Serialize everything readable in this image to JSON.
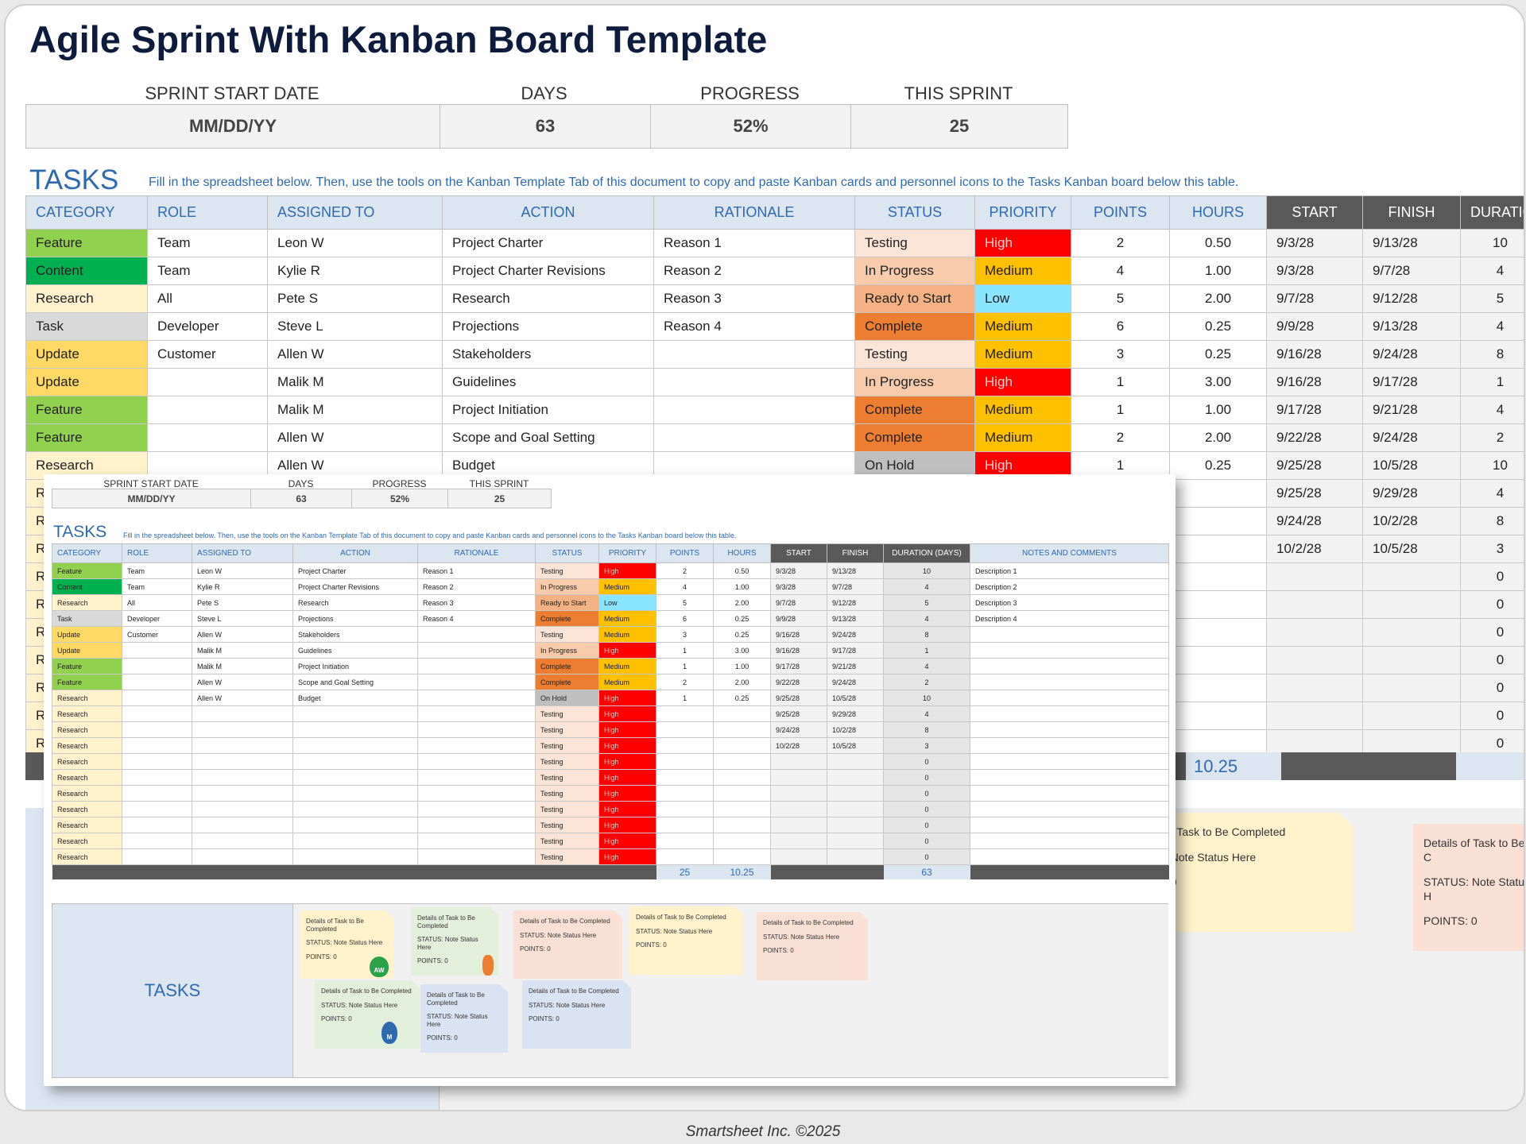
{
  "title": "Agile Sprint With Kanban Board Template",
  "summary": {
    "labels": [
      "SPRINT START DATE",
      "DAYS",
      "PROGRESS",
      "THIS SPRINT"
    ],
    "values": [
      "MM/DD/YY",
      "63",
      "52%",
      "25"
    ]
  },
  "tasks_heading": "TASKS",
  "instructions": "Fill in the spreadsheet below. Then, use the tools on the Kanban Template Tab of this document to copy and paste Kanban cards and personnel icons to the Tasks Kanban board below this table.",
  "columns": [
    "CATEGORY",
    "ROLE",
    "ASSIGNED TO",
    "ACTION",
    "RATIONALE",
    "STATUS",
    "PRIORITY",
    "POINTS",
    "HOURS",
    "START",
    "FINISH",
    "DURATION (DAYS)",
    "NOTES AND COMMENTS"
  ],
  "big_columns": [
    "CATEGORY",
    "ROLE",
    "ASSIGNED TO",
    "ACTION",
    "RATIONALE",
    "STATUS",
    "PRIORITY",
    "POINTS",
    "HOURS",
    "START",
    "FINISH",
    "DURATIC"
  ],
  "rows": [
    {
      "category": "Feature",
      "role": "Team",
      "assigned": "Leon W",
      "action": "Project Charter",
      "rationale": "Reason 1",
      "status": "Testing",
      "priority": "High",
      "points": "2",
      "hours": "0.50",
      "start": "9/3/28",
      "finish": "9/13/28",
      "duration": "10",
      "notes": "Description 1"
    },
    {
      "category": "Content",
      "role": "Team",
      "assigned": "Kylie R",
      "action": "Project Charter Revisions",
      "rationale": "Reason 2",
      "status": "In Progress",
      "priority": "Medium",
      "points": "4",
      "hours": "1.00",
      "start": "9/3/28",
      "finish": "9/7/28",
      "duration": "4",
      "notes": "Description 2"
    },
    {
      "category": "Research",
      "role": "All",
      "assigned": "Pete S",
      "action": "Research",
      "rationale": "Reason 3",
      "status": "Ready to Start",
      "priority": "Low",
      "points": "5",
      "hours": "2.00",
      "start": "9/7/28",
      "finish": "9/12/28",
      "duration": "5",
      "notes": "Description 3"
    },
    {
      "category": "Task",
      "role": "Developer",
      "assigned": "Steve L",
      "action": "Projections",
      "rationale": "Reason 4",
      "status": "Complete",
      "priority": "Medium",
      "points": "6",
      "hours": "0.25",
      "start": "9/9/28",
      "finish": "9/13/28",
      "duration": "4",
      "notes": "Description 4"
    },
    {
      "category": "Update",
      "role": "Customer",
      "assigned": "Allen W",
      "action": "Stakeholders",
      "rationale": "",
      "status": "Testing",
      "priority": "Medium",
      "points": "3",
      "hours": "0.25",
      "start": "9/16/28",
      "finish": "9/24/28",
      "duration": "8",
      "notes": ""
    },
    {
      "category": "Update",
      "role": "",
      "assigned": "Malik M",
      "action": "Guidelines",
      "rationale": "",
      "status": "In Progress",
      "priority": "High",
      "points": "1",
      "hours": "3.00",
      "start": "9/16/28",
      "finish": "9/17/28",
      "duration": "1",
      "notes": ""
    },
    {
      "category": "Feature",
      "role": "",
      "assigned": "Malik M",
      "action": "Project Initiation",
      "rationale": "",
      "status": "Complete",
      "priority": "Medium",
      "points": "1",
      "hours": "1.00",
      "start": "9/17/28",
      "finish": "9/21/28",
      "duration": "4",
      "notes": ""
    },
    {
      "category": "Feature",
      "role": "",
      "assigned": "Allen W",
      "action": "Scope and Goal Setting",
      "rationale": "",
      "status": "Complete",
      "priority": "Medium",
      "points": "2",
      "hours": "2.00",
      "start": "9/22/28",
      "finish": "9/24/28",
      "duration": "2",
      "notes": ""
    },
    {
      "category": "Research",
      "role": "",
      "assigned": "Allen W",
      "action": "Budget",
      "rationale": "",
      "status": "On Hold",
      "priority": "High",
      "points": "1",
      "hours": "0.25",
      "start": "9/25/28",
      "finish": "10/5/28",
      "duration": "10",
      "notes": ""
    },
    {
      "category": "Research",
      "role": "",
      "assigned": "",
      "action": "",
      "rationale": "",
      "status": "Testing",
      "priority": "High",
      "points": "",
      "hours": "",
      "start": "9/25/28",
      "finish": "9/29/28",
      "duration": "4",
      "notes": ""
    },
    {
      "category": "Research",
      "role": "",
      "assigned": "",
      "action": "",
      "rationale": "",
      "status": "Testing",
      "priority": "High",
      "points": "",
      "hours": "",
      "start": "9/24/28",
      "finish": "10/2/28",
      "duration": "8",
      "notes": ""
    },
    {
      "category": "Research",
      "role": "",
      "assigned": "",
      "action": "",
      "rationale": "",
      "status": "Testing",
      "priority": "High",
      "points": "",
      "hours": "",
      "start": "10/2/28",
      "finish": "10/5/28",
      "duration": "3",
      "notes": ""
    },
    {
      "category": "Research",
      "role": "",
      "assigned": "",
      "action": "",
      "rationale": "",
      "status": "Testing",
      "priority": "High",
      "points": "",
      "hours": "",
      "start": "",
      "finish": "",
      "duration": "0",
      "notes": ""
    },
    {
      "category": "Research",
      "role": "",
      "assigned": "",
      "action": "",
      "rationale": "",
      "status": "Testing",
      "priority": "High",
      "points": "",
      "hours": "",
      "start": "",
      "finish": "",
      "duration": "0",
      "notes": ""
    },
    {
      "category": "Research",
      "role": "",
      "assigned": "",
      "action": "",
      "rationale": "",
      "status": "Testing",
      "priority": "High",
      "points": "",
      "hours": "",
      "start": "",
      "finish": "",
      "duration": "0",
      "notes": ""
    },
    {
      "category": "Research",
      "role": "",
      "assigned": "",
      "action": "",
      "rationale": "",
      "status": "Testing",
      "priority": "High",
      "points": "",
      "hours": "",
      "start": "",
      "finish": "",
      "duration": "0",
      "notes": ""
    },
    {
      "category": "Research",
      "role": "",
      "assigned": "",
      "action": "",
      "rationale": "",
      "status": "Testing",
      "priority": "High",
      "points": "",
      "hours": "",
      "start": "",
      "finish": "",
      "duration": "0",
      "notes": ""
    },
    {
      "category": "Research",
      "role": "",
      "assigned": "",
      "action": "",
      "rationale": "",
      "status": "Testing",
      "priority": "High",
      "points": "",
      "hours": "",
      "start": "",
      "finish": "",
      "duration": "0",
      "notes": ""
    },
    {
      "category": "Research",
      "role": "",
      "assigned": "",
      "action": "",
      "rationale": "",
      "status": "Testing",
      "priority": "High",
      "points": "",
      "hours": "",
      "start": "",
      "finish": "",
      "duration": "0",
      "notes": ""
    }
  ],
  "totals": {
    "points": "25",
    "hours": "10.25",
    "duration": "63",
    "big_duration_partial": "6"
  },
  "kanban_label": "TASKS",
  "note": {
    "title": "Details of Task to Be Completed",
    "status": "STATUS: Note Status Here",
    "points": "POINTS: 0"
  },
  "big_notes": [
    {
      "title": "of Task to Be Completed",
      "status": ": Note Status Here",
      "points": ": 0"
    },
    {
      "title": "Details of Task to Be C",
      "status": "STATUS: Note Status H",
      "points": "POINTS: 0"
    }
  ],
  "avatars": [
    "AW",
    "M"
  ],
  "colors": {
    "category": {
      "Feature": "#92d050",
      "Content": "#00b050",
      "Research": "#fff2cc",
      "Task": "#d9d9d9",
      "Update": "#ffd966"
    },
    "status": {
      "Testing": "#fce4d6",
      "In Progress": "#f8cbad",
      "Ready to Start": "#f4b183",
      "Complete": "#ed7d31",
      "On Hold": "#bfbfbf"
    },
    "priority": {
      "High": "#ff0000",
      "Medium": "#ffc000",
      "Low": "#8ae6ff"
    },
    "accent": "#2e6ab0",
    "title": "#0d1b3d"
  },
  "copyright": "Smartsheet Inc. ©2025"
}
